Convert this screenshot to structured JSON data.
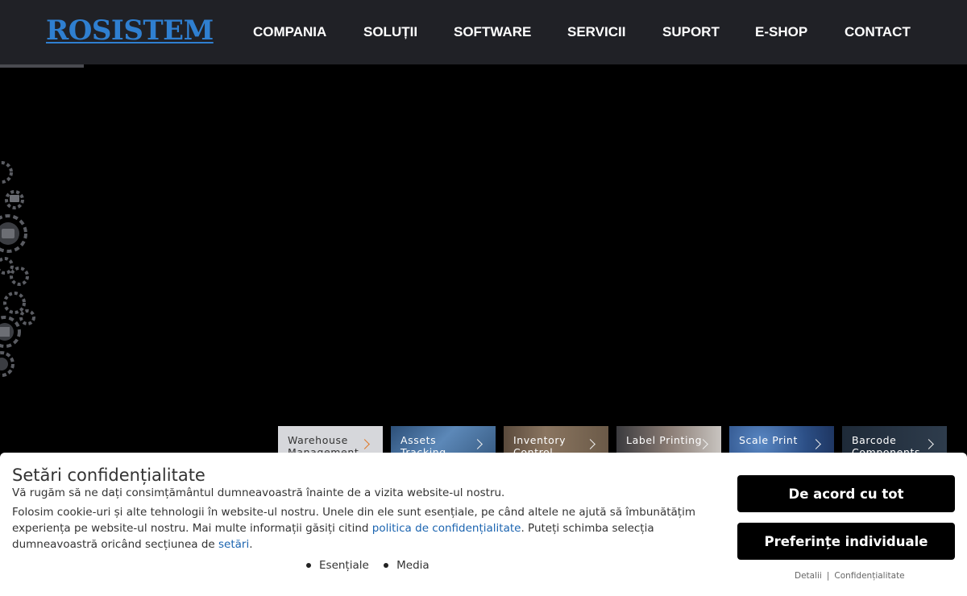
{
  "header": {
    "logo": "ROSISTEM",
    "nav": [
      "COMPANIA",
      "SOLUȚII",
      "SOFTWARE",
      "SERVICII",
      "SUPORT",
      "E-SHOP",
      "CONTACT"
    ]
  },
  "thumbnails": [
    {
      "label": "Warehouse Management",
      "active": true
    },
    {
      "label": "Assets Tracking",
      "active": false
    },
    {
      "label": "Inventory Control",
      "active": false
    },
    {
      "label": "Label Printing",
      "active": false
    },
    {
      "label": "Scale Print",
      "active": false
    },
    {
      "label": "Barcode Components",
      "active": false
    }
  ],
  "cookie": {
    "title": "Setări confidențialitate",
    "subtitle": "Vă rugăm să ne dați consimțământul dumneavoastră înainte de a vizita website-ul nostru.",
    "text_before_link": "Folosim cookie-uri și alte tehnologii în website-ul nostru. Unele din ele sunt esențiale, pe când altele ne ajută să îmbunătățim experiența pe website-ul nostru. Mai multe informații găsiți citind ",
    "policy_link": "politica de confidențialitate",
    "text_middle": ". Puteți schimba selecția dumneavoastră oricând secțiunea de ",
    "settings_link": "setări",
    "text_end": ".",
    "categories": [
      "Esențiale",
      "Media"
    ],
    "accept_label": "De acord cu tot",
    "prefs_label": "Preferințe individuale",
    "details_link": "Detalii",
    "links_separator": "|",
    "privacy_link": "Confidențialitate"
  },
  "colors": {
    "header_bg": "#202126",
    "logo": "#2f7fd0",
    "link": "#1b64b0",
    "active_chevron": "#e07a2a"
  }
}
